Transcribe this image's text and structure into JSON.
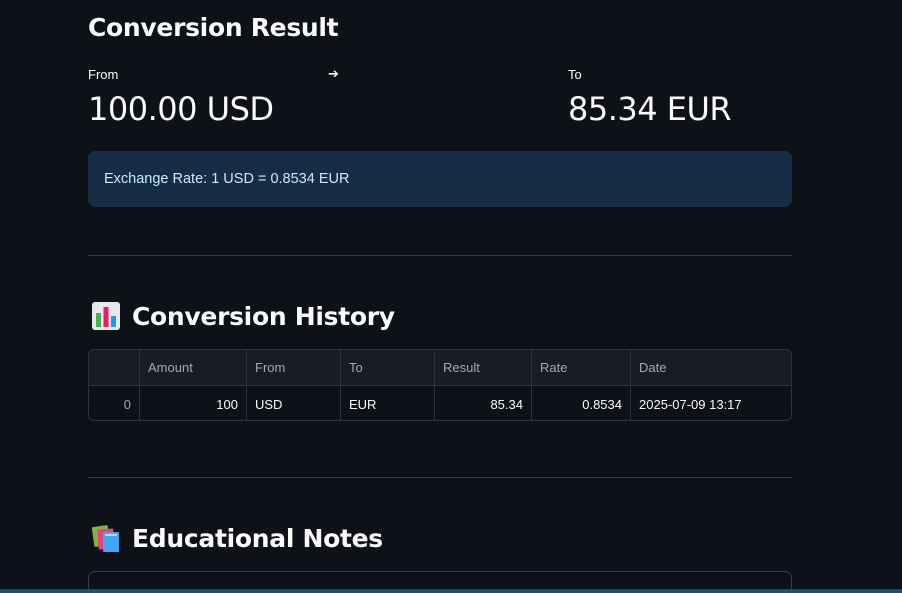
{
  "result": {
    "title": "Conversion Result",
    "from_label": "From",
    "from_value": "100.00 USD",
    "arrow": "➔",
    "to_label": "To",
    "to_value": "85.34 EUR",
    "exchange_rate": "Exchange Rate: 1 USD = 0.8534 EUR"
  },
  "history": {
    "icon": "bar-chart-icon",
    "title": "Conversion History",
    "columns": [
      "",
      "Amount",
      "From",
      "To",
      "Result",
      "Rate",
      "Date"
    ],
    "rows": [
      {
        "index": "0",
        "amount": "100",
        "from": "USD",
        "to": "EUR",
        "result": "85.34",
        "rate": "0.8534",
        "date": "2025-07-09 13:17"
      }
    ]
  },
  "notes": {
    "icon": "books-icon",
    "title": "Educational Notes"
  },
  "colors": {
    "background": "#0e1117",
    "info_bg": "#172d43",
    "info_text": "#c7ebff"
  }
}
